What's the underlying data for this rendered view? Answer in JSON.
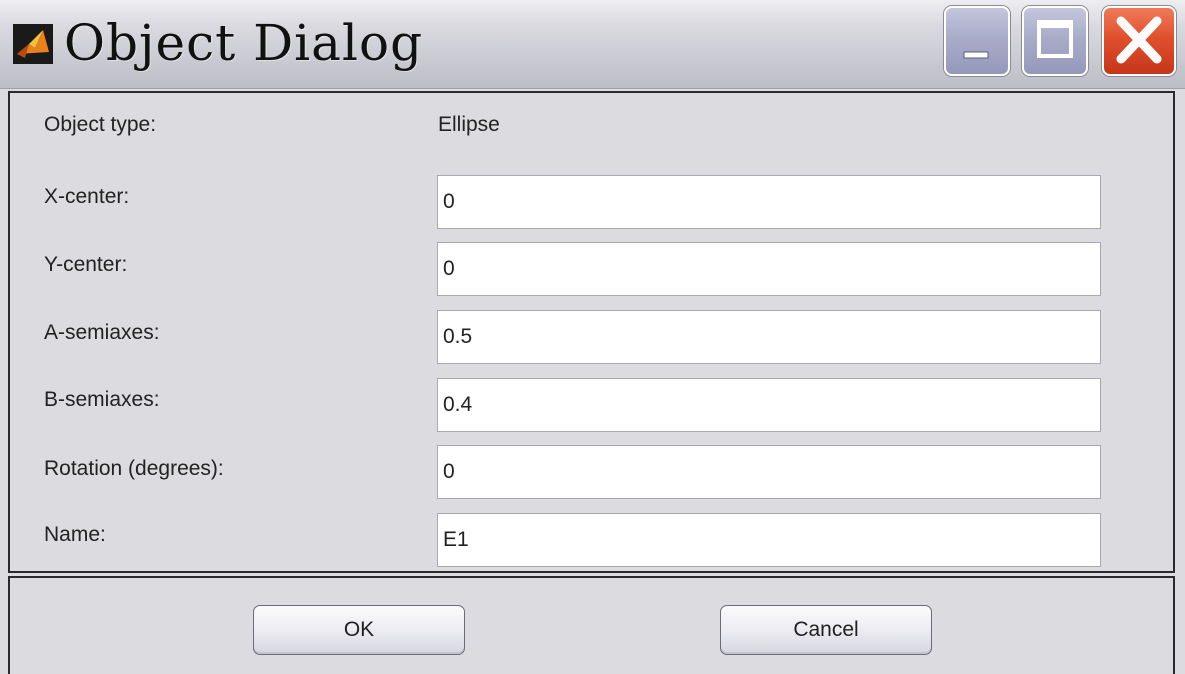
{
  "window": {
    "title": "Object Dialog",
    "controls": [
      "minimize-icon",
      "maximize-icon",
      "close-icon"
    ]
  },
  "form": {
    "object_type_label": "Object type:",
    "object_type_value": "Ellipse",
    "fields": [
      {
        "label": "X-center:",
        "value": "0"
      },
      {
        "label": "Y-center:",
        "value": "0"
      },
      {
        "label": "A-semiaxes:",
        "value": "0.5"
      },
      {
        "label": "B-semiaxes:",
        "value": "0.4"
      },
      {
        "label": "Rotation (degrees):",
        "value": "0"
      },
      {
        "label": "Name:",
        "value": "E1"
      }
    ]
  },
  "buttons": {
    "ok_label": "OK",
    "cancel_label": "Cancel"
  },
  "colors": {
    "background": "#dcdce0",
    "close_button": "#e0502c"
  }
}
